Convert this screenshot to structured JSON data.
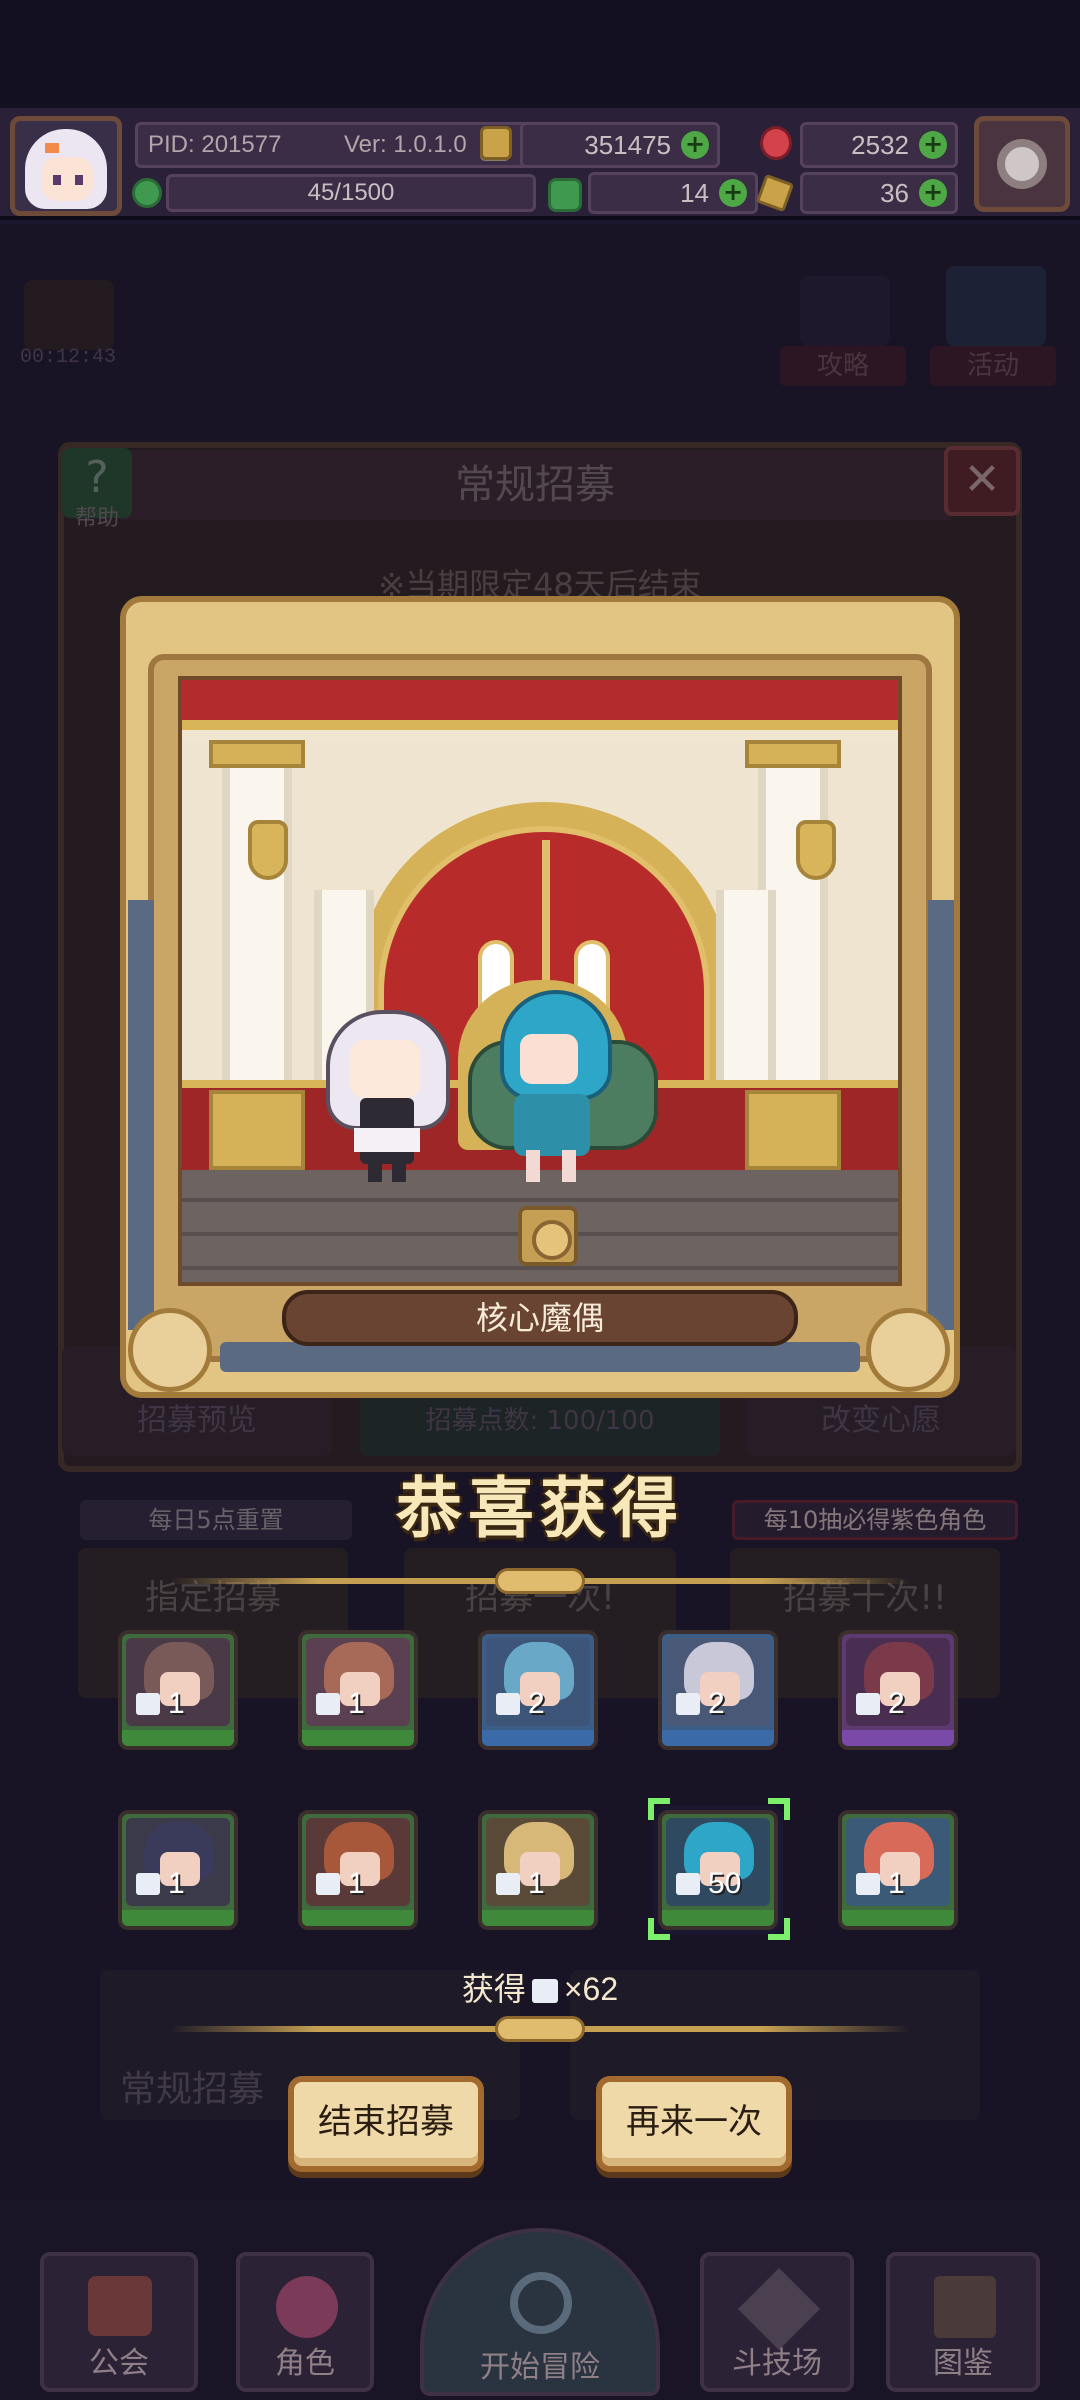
{
  "header": {
    "pid": "PID: 201577",
    "version": "Ver: 1.0.1.0",
    "xp": "45/1500",
    "gold": "351475",
    "gems": "2532",
    "clovers": "14",
    "tickets": "36"
  },
  "background": {
    "timer": "00:12:43",
    "guide_label": "攻略",
    "event_label": "活动",
    "panel_title": "常规招募",
    "help_label": "帮助",
    "limited_notice": "※当期限定48天后结束",
    "preview_label": "招募预览",
    "points_label": "招募点数: 100/100",
    "wish_label": "改变心愿",
    "daily_reset": "每日5点重置",
    "guarantee": "每10抽必得紫色角色",
    "designated": "指定招募",
    "recruit_once": "招募一次!",
    "recruit_ten": "招募十次!!",
    "banner_label": "常规招募"
  },
  "result": {
    "character_name": "核心魔偶",
    "congrats": "恭喜获得",
    "obtain_label": "获得",
    "obtain_total": "×62",
    "cards": [
      {
        "count": "1",
        "rarity": "green"
      },
      {
        "count": "1",
        "rarity": "green"
      },
      {
        "count": "2",
        "rarity": "blue"
      },
      {
        "count": "2",
        "rarity": "blue"
      },
      {
        "count": "2",
        "rarity": "purple"
      },
      {
        "count": "1",
        "rarity": "green"
      },
      {
        "count": "1",
        "rarity": "green"
      },
      {
        "count": "1",
        "rarity": "green"
      },
      {
        "count": "50",
        "rarity": "green",
        "selected": true
      },
      {
        "count": "1",
        "rarity": "green"
      }
    ],
    "end_button": "结束招募",
    "again_button": "再来一次"
  },
  "nav": {
    "guild": "公会",
    "character": "角色",
    "adventure": "开始冒险",
    "arena": "斗技场",
    "codex": "图鉴"
  },
  "colors": {
    "accent_gold": "#c6a052",
    "selected_outline": "#7cf06a",
    "button_face": "#f0d9a8"
  }
}
